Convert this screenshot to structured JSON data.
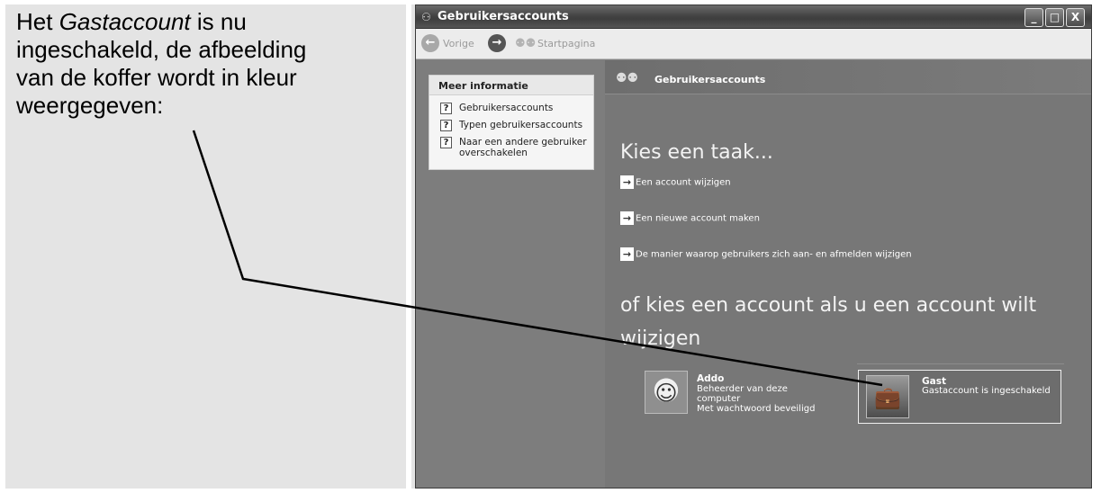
{
  "caption": {
    "line1_pre": "Het ",
    "line1_em": "Gastaccount",
    "line1_post": " is nu",
    "line2": "ingeschakeld, de afbeelding",
    "line3": "van de koffer wordt in kleur",
    "line4": "weergegeven:"
  },
  "window": {
    "title": "Gebruikersaccounts",
    "title_icon": "users-icon",
    "controls": {
      "minimize": "_",
      "maximize": "□",
      "close": "X"
    }
  },
  "toolbar": {
    "back_label": "Vorige",
    "back_icon": "back-arrow-icon",
    "forward_icon": "forward-arrow-icon",
    "home_label": "Startpagina",
    "home_icon": "users-home-icon"
  },
  "sidebar": {
    "box_title": "Meer informatie",
    "links": [
      {
        "label": "Gebruikersaccounts",
        "icon": "help-icon"
      },
      {
        "label": "Typen gebruikersaccounts",
        "icon": "help-icon"
      },
      {
        "label": "Naar een andere gebruiker overschakelen",
        "icon": "help-icon"
      }
    ]
  },
  "content": {
    "header_title": "Gebruikersaccounts",
    "task_heading": "Kies een taak...",
    "tasks": [
      {
        "label": "Een account wijzigen",
        "icon": "arrow-right-icon"
      },
      {
        "label": "Een nieuwe account maken",
        "icon": "arrow-right-icon"
      },
      {
        "label": "De manier waarop gebruikers zich aan- en afmelden wijzigen",
        "icon": "arrow-right-icon"
      }
    ],
    "account_heading": "of kies een account als u een account wilt wijzigen",
    "accounts": [
      {
        "name": "Addo",
        "description": [
          "Beheerder van deze",
          "computer",
          "Met wachtwoord beveiligd"
        ],
        "avatar": "frog-avatar"
      },
      {
        "name": "Gast",
        "description": [
          "Gastaccount is ingeschakeld"
        ],
        "avatar": "suitcase-avatar"
      }
    ]
  }
}
